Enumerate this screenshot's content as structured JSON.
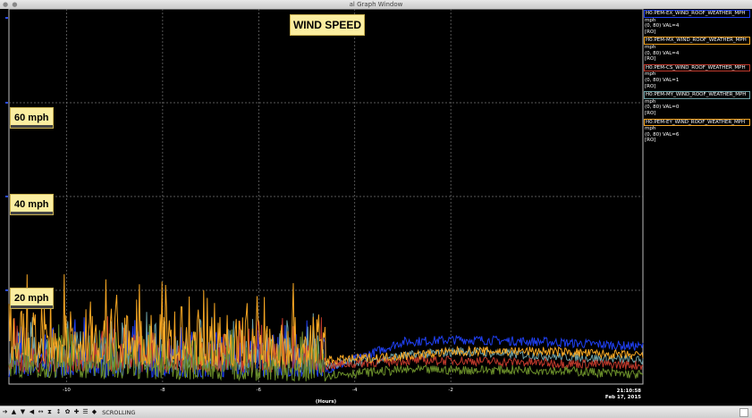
{
  "window": {
    "title": "al Graph Window"
  },
  "chart_data": {
    "type": "line",
    "title": "WIND SPEED",
    "xlabel": "(Hours)",
    "ylabel": "",
    "xlim": [
      -11.2,
      2.0
    ],
    "ylim": [
      0,
      80
    ],
    "x_ticks": [
      -10,
      -8,
      -6,
      -4,
      -2
    ],
    "y_ticks": [
      20,
      40,
      60
    ],
    "y_tick_labels": [
      "20 mph",
      "40 mph",
      "60 mph"
    ],
    "timestamp": "21:10:58",
    "date": "Feb 17, 2015",
    "grid": true,
    "legend_position": "right",
    "series": [
      {
        "name": "H0:PEM-EX_WIND_ROOF_WEATHER_MPH",
        "units": "mph",
        "range": "(0, 80) VAL=4",
        "mode": "[RO]",
        "color": "#1f3ff0",
        "levels": [
          [
            -11.2,
            3
          ],
          [
            -4.6,
            3
          ],
          [
            -3.0,
            9
          ],
          [
            -1.8,
            9.5
          ],
          [
            0,
            9
          ],
          [
            2.0,
            8
          ]
        ]
      },
      {
        "name": "H0:PEM-MX_WIND_ROOF_WEATHER_MPH",
        "units": "mph",
        "range": "(0, 80) VAL=4",
        "mode": "[RO]",
        "color": "#f5a623",
        "levels": [
          [
            -11.2,
            6
          ],
          [
            -4.6,
            5
          ],
          [
            -3.0,
            6
          ],
          [
            -1.8,
            7
          ],
          [
            0,
            7
          ],
          [
            2.0,
            6
          ]
        ]
      },
      {
        "name": "H0:PEM-CS_WIND_ROOF_WEATHER_MPH",
        "units": "mph",
        "range": "(0, 80) VAL=1",
        "mode": "[RO]",
        "color": "#c0392b",
        "levels": [
          [
            -11.2,
            4
          ],
          [
            -4.6,
            4
          ],
          [
            -3.0,
            5
          ],
          [
            -1.8,
            5
          ],
          [
            0,
            4.5
          ],
          [
            2.0,
            4
          ]
        ]
      },
      {
        "name": "H0:PEM-MY_WIND_ROOF_WEATHER_MPH",
        "units": "mph",
        "range": "(0, 80) VAL=0",
        "mode": "[RO]",
        "color": "#6fa3a8",
        "levels": [
          [
            -11.2,
            5
          ],
          [
            -4.6,
            4
          ],
          [
            -3.0,
            6
          ],
          [
            -1.8,
            7
          ],
          [
            0,
            6
          ],
          [
            2.0,
            5
          ]
        ]
      },
      {
        "name": "H0:PEM-EY_WIND_ROOF_WEATHER_MPH",
        "units": "mph",
        "range": "(0, 80) VAL=6",
        "mode": "[RO]",
        "color": "#6b8f2a",
        "levels": [
          [
            -11.2,
            3
          ],
          [
            -4.6,
            2
          ],
          [
            -3.0,
            3
          ],
          [
            -1.8,
            3
          ],
          [
            0,
            3
          ],
          [
            2.0,
            2
          ]
        ]
      }
    ]
  },
  "toolbar": {
    "status_text": "SCROLLING",
    "icons": [
      "arrow-right",
      "arrow-up",
      "arrow-down",
      "arrow-left",
      "expand-h",
      "expand-v",
      "expand-h-2",
      "settings",
      "add",
      "zoom",
      "target"
    ]
  }
}
